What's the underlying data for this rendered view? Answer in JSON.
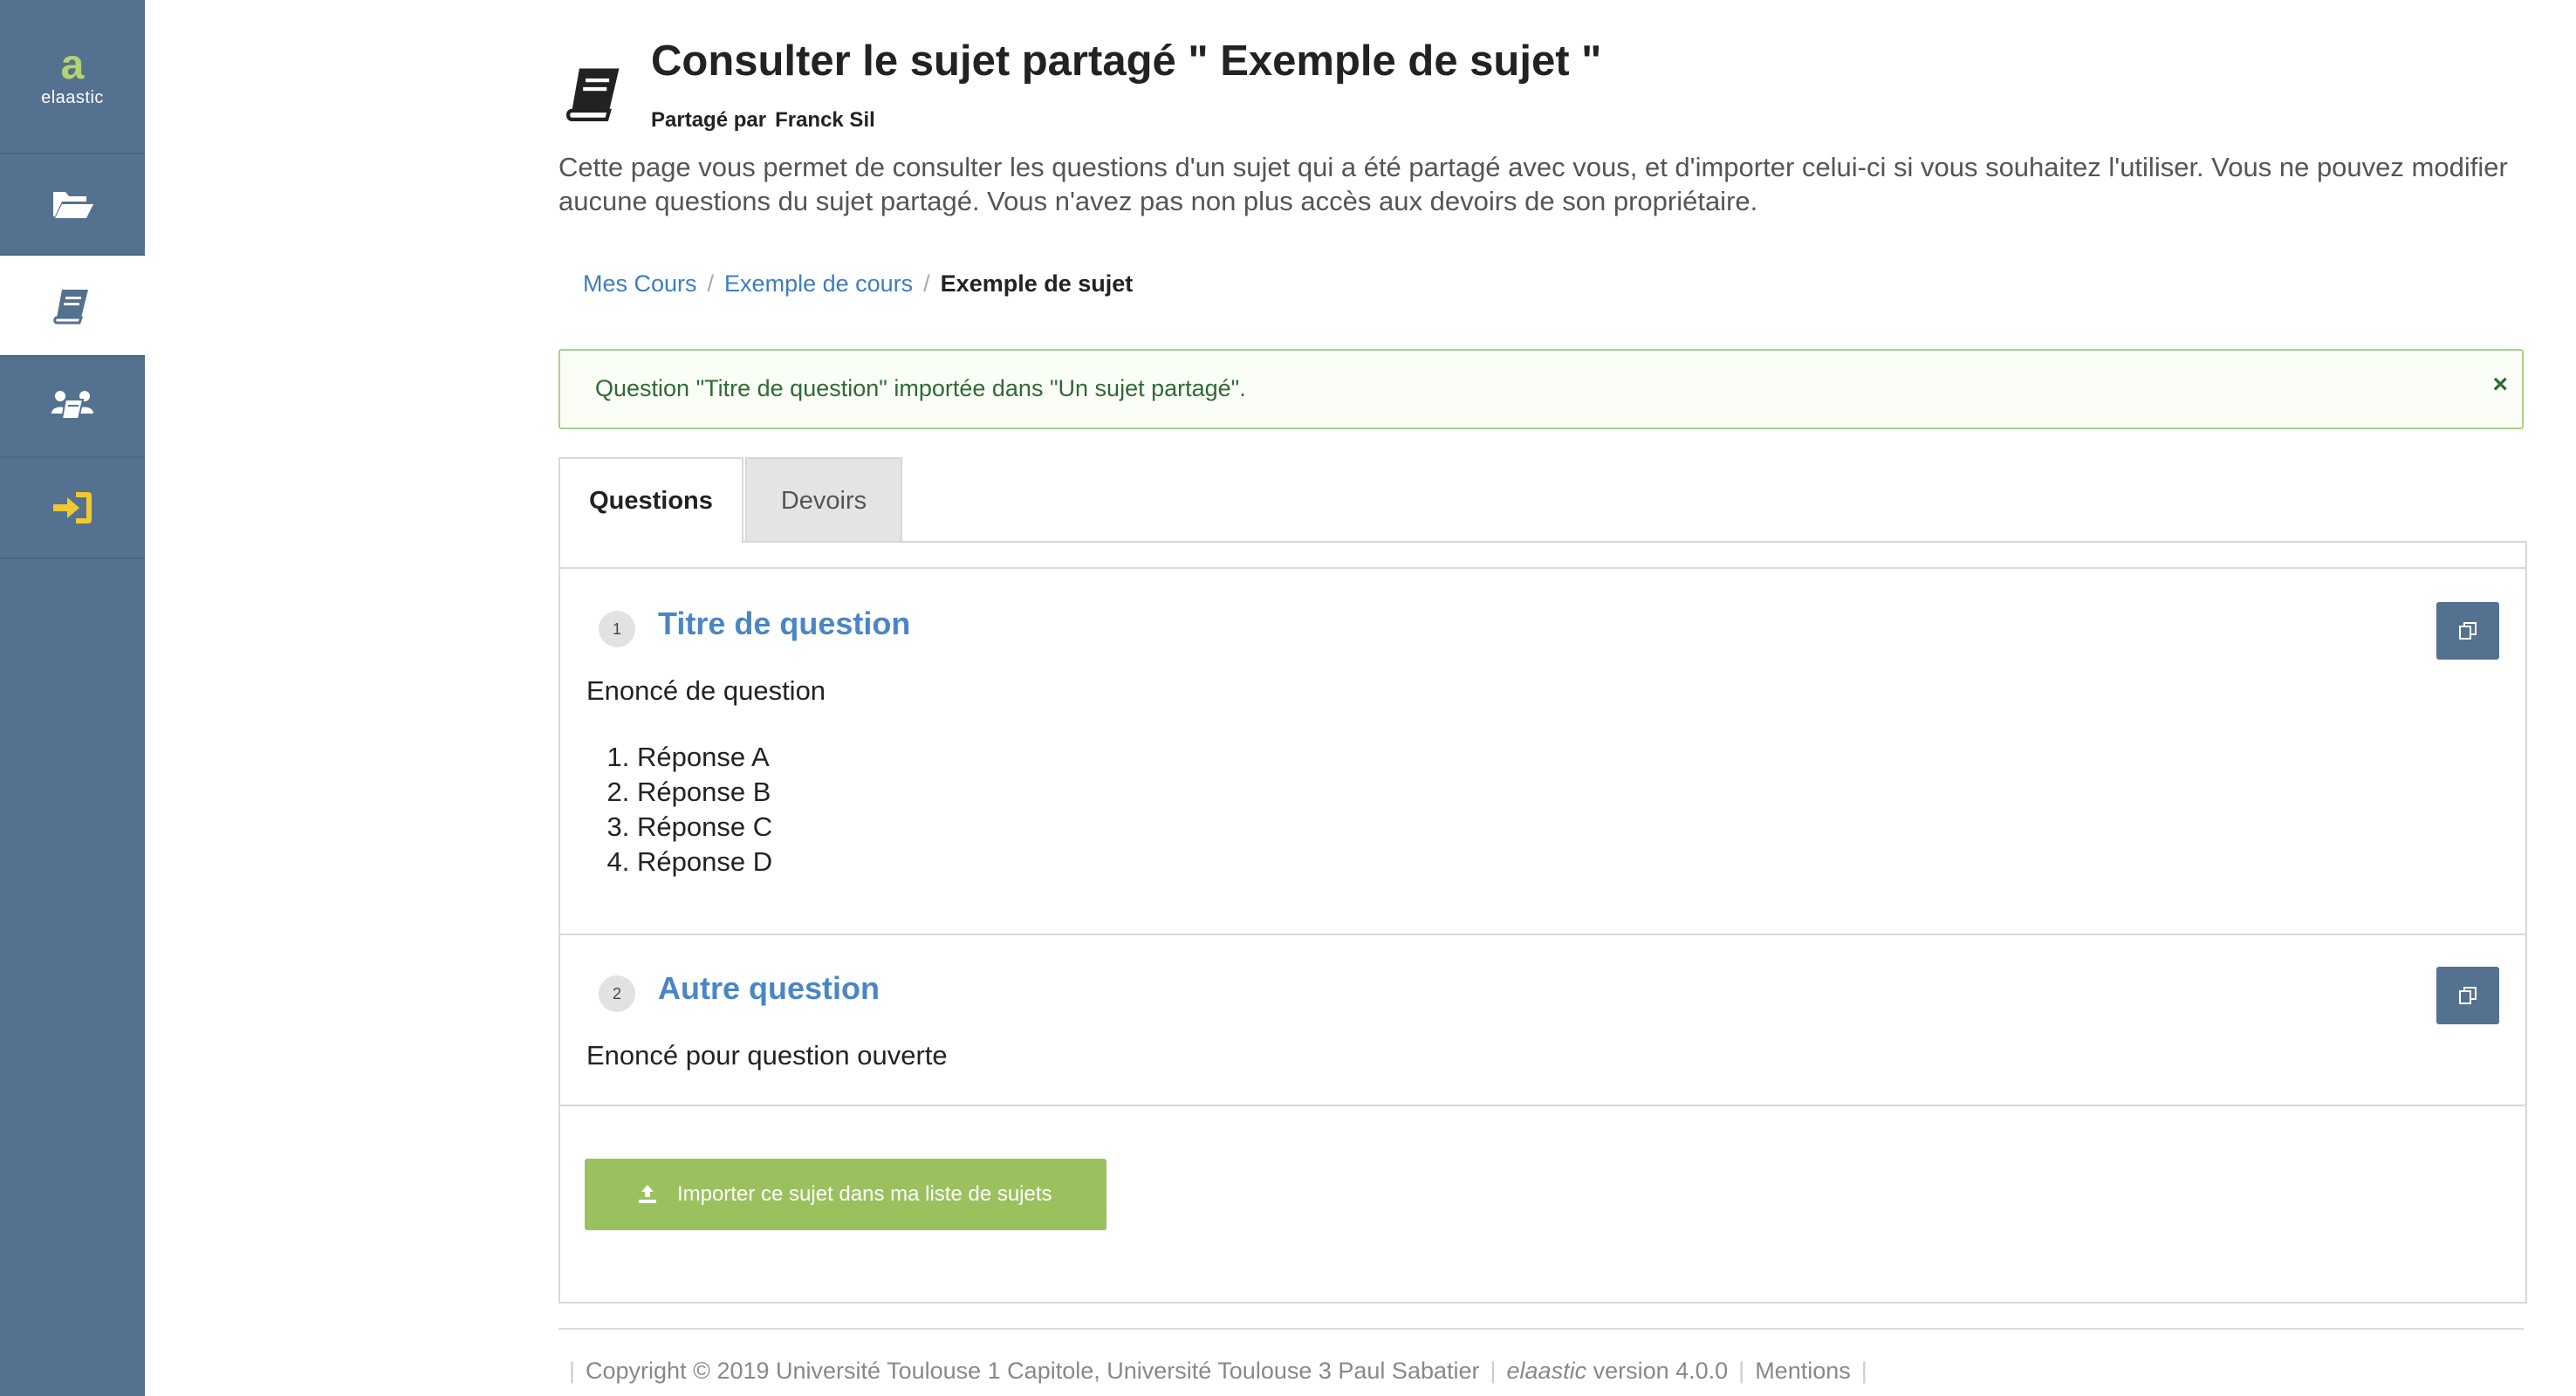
{
  "sidebar": {
    "logo": {
      "mark": "a",
      "text": "elaastic"
    },
    "items": [
      {
        "icon": "folder-open-icon"
      },
      {
        "icon": "book-icon",
        "active": true
      },
      {
        "icon": "users-book-icon"
      },
      {
        "icon": "sign-in-icon"
      }
    ]
  },
  "header": {
    "icon": "book-icon",
    "title": "Consulter le sujet partagé \" Exemple de sujet \"",
    "shared_by_label": "Partagé par",
    "shared_by_name": "Franck Sil",
    "description": "Cette page vous permet de consulter les questions d'un sujet qui a été partagé avec vous, et d'importer celui-ci si vous souhaitez l'utiliser. Vous ne pouvez modifier aucune questions du sujet partagé. Vous n'avez pas non plus accès aux devoirs de son propriétaire."
  },
  "breadcrumb": {
    "items": [
      "Mes Cours",
      "Exemple de cours"
    ],
    "separator": "/",
    "current": "Exemple de sujet"
  },
  "alert": {
    "message": "Question \"Titre de question\" importée dans \"Un sujet partagé\".",
    "close": "×",
    "color": "#2e6b33"
  },
  "tabs": [
    {
      "label": "Questions",
      "active": true
    },
    {
      "label": "Devoirs",
      "active": false
    }
  ],
  "questions": [
    {
      "number": "1",
      "title": "Titre de question",
      "statement": "Enoncé de question",
      "answers": [
        "Réponse A",
        "Réponse B",
        "Réponse C",
        "Réponse D"
      ]
    },
    {
      "number": "2",
      "title": "Autre question",
      "statement": "Enoncé pour question ouverte"
    }
  ],
  "import_button": {
    "label": "Importer ce sujet dans ma liste de sujets",
    "icon": "upload-icon"
  },
  "footer": {
    "copyright": "Copyright © 2019 Université Toulouse 1 Capitole, Université Toulouse 3 Paul Sabatier",
    "app_name": "elaastic",
    "version": "version 4.0.0",
    "mentions": "Mentions"
  },
  "colors": {
    "sidebar": "#54718f",
    "link": "#3e7cc0",
    "question_title": "#4a86c5",
    "import_button": "#9bc15e",
    "logo_accent": "#b5d36e"
  }
}
